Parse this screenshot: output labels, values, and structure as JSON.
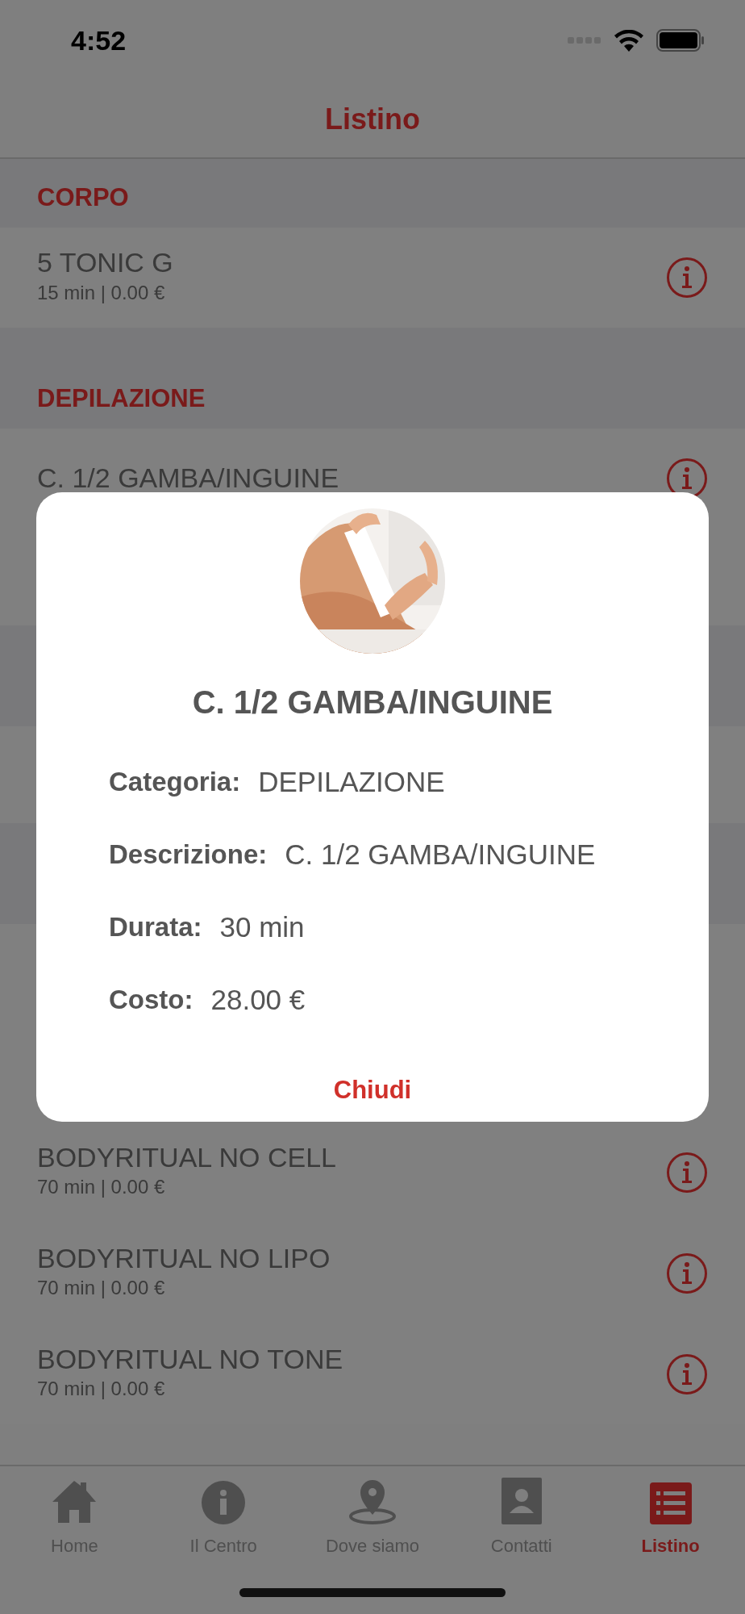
{
  "status_bar": {
    "time": "4:52"
  },
  "nav": {
    "title": "Listino"
  },
  "sections": [
    {
      "title": "CORPO",
      "items": [
        {
          "name": "5 TONIC G",
          "detail": "15 min | 0.00 €"
        }
      ]
    },
    {
      "title": "DEPILAZIONE",
      "items": [
        {
          "name": "C. 1/2 GAMBA/INGUINE"
        }
      ]
    }
  ],
  "list_below": [
    {
      "name": "BODYRITUAL NO CELL",
      "detail": "70 min | 0.00 €"
    },
    {
      "name": "BODYRITUAL NO LIPO",
      "detail": "70 min | 0.00 €"
    },
    {
      "name": "BODYRITUAL NO TONE",
      "detail": "70 min | 0.00 €"
    }
  ],
  "dialog": {
    "title": "C. 1/2 GAMBA/INGUINE",
    "fields": [
      {
        "label": "Categoria:",
        "value": "DEPILAZIONE"
      },
      {
        "label": "Descrizione:",
        "value": "C. 1/2 GAMBA/INGUINE"
      },
      {
        "label": "Durata:",
        "value": "30 min"
      },
      {
        "label": "Costo:",
        "value": "28.00 €"
      }
    ],
    "close_button": "Chiudi"
  },
  "tab_bar": [
    {
      "label": "Home",
      "kind": "home",
      "selected": false
    },
    {
      "label": "Il Centro",
      "kind": "info",
      "selected": false
    },
    {
      "label": "Dove siamo",
      "kind": "pin",
      "selected": false
    },
    {
      "label": "Contatti",
      "kind": "contact",
      "selected": false
    },
    {
      "label": "Listino",
      "kind": "list",
      "selected": true
    }
  ]
}
